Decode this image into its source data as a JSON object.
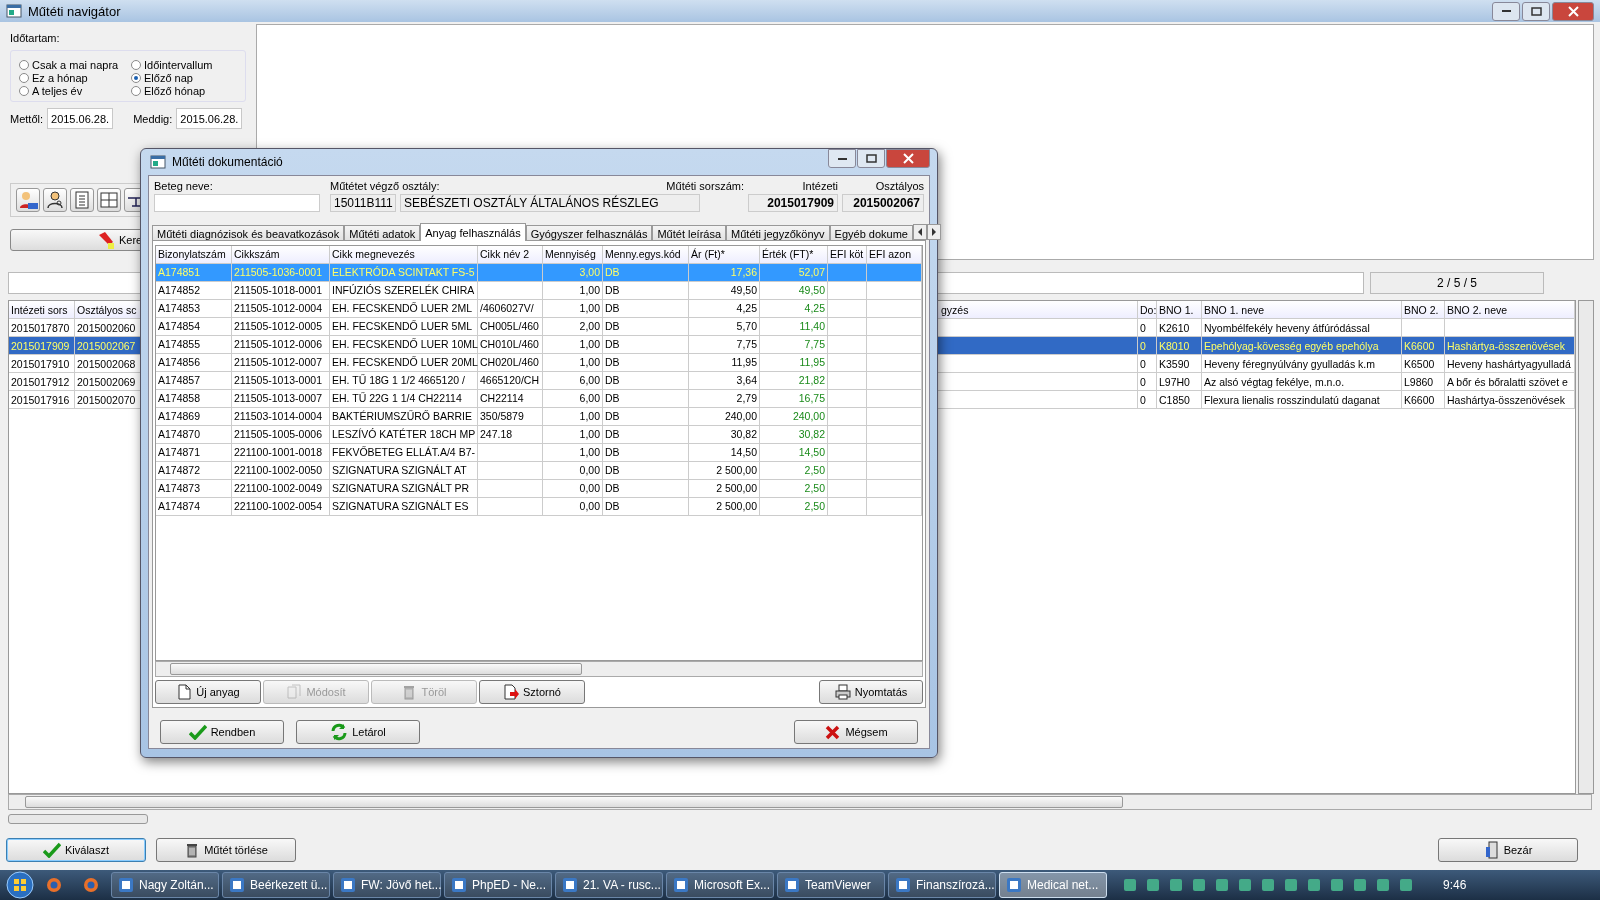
{
  "main_window": {
    "title": "Műtéti navigátor"
  },
  "period": {
    "label": "Időtartam:",
    "options": [
      {
        "label": "Csak a mai napra",
        "selected": false
      },
      {
        "label": "Időintervallum",
        "selected": false
      },
      {
        "label": "Ez a hónap",
        "selected": false
      },
      {
        "label": "Előző nap",
        "selected": true
      },
      {
        "label": "A teljes év",
        "selected": false
      },
      {
        "label": "Előző hónap",
        "selected": false
      }
    ],
    "from_label": "Mettől:",
    "from": "2015.06.28.",
    "to_label": "Meddig:",
    "to": "2015.06.28."
  },
  "search_button": "Kere",
  "record_counter": "2 / 5 / 5",
  "operations_table": {
    "columns": [
      "Intézeti sors",
      "Osztályos sc",
      "gyzés",
      "Do:",
      "BNO 1.",
      "BNO 1. neve",
      "BNO 2.",
      "BNO 2. neve"
    ],
    "rows": [
      {
        "cells": [
          "2015017870",
          "2015002060",
          null,
          "0",
          "K2610",
          "Nyombélfekély heveny átfúródással",
          null,
          null
        ],
        "selected": false
      },
      {
        "cells": [
          "2015017909",
          "2015002067",
          null,
          "0",
          "K8010",
          "Epehólyag-kövesség egyéb epehólya",
          "K6600",
          "Hashártya-összenövések"
        ],
        "selected": true
      },
      {
        "cells": [
          "2015017910",
          "2015002068",
          null,
          "0",
          "K3590",
          "Heveny féregnyúlvány gyulladás k.m",
          "K6500",
          "Heveny hashártyagyulladá"
        ],
        "selected": false
      },
      {
        "cells": [
          "2015017912",
          "2015002069",
          null,
          "0",
          "L97H0",
          "Az alsó végtag fekélye, m.n.o.",
          "L9860",
          "A bőr és bőralatti szövet e"
        ],
        "selected": false
      },
      {
        "cells": [
          "2015017916",
          "2015002070",
          null,
          "0",
          "C1850",
          "Flexura lienalis rosszindulatú daganat",
          "K6600",
          "Hashártya-összenövések"
        ],
        "selected": false
      }
    ]
  },
  "bottom_buttons": [
    {
      "label": "Kiválaszt",
      "kind": "select"
    },
    {
      "label": "Műtét törlése",
      "kind": "delete"
    },
    {
      "label": "Bezár",
      "kind": "close"
    }
  ],
  "dialog": {
    "title": "Műtéti dokumentáció",
    "patient_label": "Beteg neve:",
    "department_label": "Műtétet végző osztály:",
    "department_code": "15011B111",
    "department_name": "SEBÉSZETI OSZTÁLY ÁLTALÁNOS RÉSZLEG",
    "serial_label": "Műtéti sorszám:",
    "institution_label": "Intézeti",
    "institution_serial": "2015017909",
    "department_serial_label": "Osztályos",
    "department_serial": "2015002067",
    "tabs": [
      {
        "label": "Műtéti diagnózisok és beavatkozások",
        "selected": false
      },
      {
        "label": "Műtéti adatok",
        "selected": false
      },
      {
        "label": "Anyag felhasználás",
        "selected": true
      },
      {
        "label": "Gyógyszer felhasználás",
        "selected": false
      },
      {
        "label": "Műtét leírása",
        "selected": false
      },
      {
        "label": "Műtéti jegyzőkönyv",
        "selected": false
      },
      {
        "label": "Egyéb dokume",
        "selected": false
      }
    ],
    "table": {
      "columns": [
        "Bizonylatszám",
        "Cikkszám",
        "Cikk megnevezés",
        "Cikk név 2",
        "Mennyiség",
        "Menny.egys.kód",
        "Ár (Ft)*",
        "Érték (FT)*",
        "EFI köt",
        "EFI azon"
      ],
      "rows": [
        {
          "cells": [
            "A174851",
            "211505-1036-0001",
            "ELEKTRÓDA SCINTAKT FS-5",
            null,
            "3,00",
            "DB",
            "17,36",
            "52,07",
            null,
            null
          ],
          "selected": true
        },
        {
          "cells": [
            "A174852",
            "211505-1018-0001",
            "INFÚZIÓS SZERELÉK CHIRA",
            null,
            "1,00",
            "DB",
            "49,50",
            "49,50",
            null,
            null
          ],
          "selected": false
        },
        {
          "cells": [
            "A174853",
            "211505-1012-0004",
            "EH. FECSKENDŐ LUER 2ML",
            "/4606027V/",
            "1,00",
            "DB",
            "4,25",
            "4,25",
            null,
            null
          ],
          "selected": false
        },
        {
          "cells": [
            "A174854",
            "211505-1012-0005",
            "EH. FECSKENDŐ LUER 5ML",
            "CH005L/460",
            "2,00",
            "DB",
            "5,70",
            "11,40",
            null,
            null
          ],
          "selected": false
        },
        {
          "cells": [
            "A174855",
            "211505-1012-0006",
            "EH. FECSKENDŐ LUER 10ML",
            "CH010L/460",
            "1,00",
            "DB",
            "7,75",
            "7,75",
            null,
            null
          ],
          "selected": false
        },
        {
          "cells": [
            "A174856",
            "211505-1012-0007",
            "EH. FECSKENDŐ LUER 20ML",
            "CH020L/460",
            "1,00",
            "DB",
            "11,95",
            "11,95",
            null,
            null
          ],
          "selected": false
        },
        {
          "cells": [
            "A174857",
            "211505-1013-0001",
            "EH. TŰ 18G 1 1/2  4665120 /",
            "4665120/CH",
            "6,00",
            "DB",
            "3,64",
            "21,82",
            null,
            null
          ],
          "selected": false
        },
        {
          "cells": [
            "A174858",
            "211505-1013-0007",
            "EH. TŰ 22G 1 1/4 CH22114",
            "CH22114",
            "6,00",
            "DB",
            "2,79",
            "16,75",
            null,
            null
          ],
          "selected": false
        },
        {
          "cells": [
            "A174869",
            "211503-1014-0004",
            "BAKTÉRIUMSZŰRŐ BARRIE",
            "350/5879",
            "1,00",
            "DB",
            "240,00",
            "240,00",
            null,
            null
          ],
          "selected": false
        },
        {
          "cells": [
            "A174870",
            "211505-1005-0006",
            "LESZÍVÓ KATÉTER 18CH MP",
            "247.18",
            "1,00",
            "DB",
            "30,82",
            "30,82",
            null,
            null
          ],
          "selected": false
        },
        {
          "cells": [
            "A174871",
            "221100-1001-0018",
            "FEKVŐBETEG ELLÁT.A/4 B7-",
            null,
            "1,00",
            "DB",
            "14,50",
            "14,50",
            null,
            null
          ],
          "selected": false
        },
        {
          "cells": [
            "A174872",
            "221100-1002-0050",
            "SZIGNATURA SZIGNÁLT AT",
            null,
            "0,00",
            "DB",
            "2 500,00",
            "2,50",
            null,
            null
          ],
          "selected": false
        },
        {
          "cells": [
            "A174873",
            "221100-1002-0049",
            "SZIGNATURA SZIGNÁLT PR",
            null,
            "0,00",
            "DB",
            "2 500,00",
            "2,50",
            null,
            null
          ],
          "selected": false
        },
        {
          "cells": [
            "A174874",
            "221100-1002-0054",
            "SZIGNATURA SZIGNÁLT ES",
            null,
            "0,00",
            "DB",
            "2 500,00",
            "2,50",
            null,
            null
          ],
          "selected": false
        }
      ]
    },
    "actions": [
      {
        "label": "Új anyag",
        "kind": "new",
        "disabled": false
      },
      {
        "label": "Módosít",
        "kind": "edit",
        "disabled": true
      },
      {
        "label": "Töröl",
        "kind": "delete",
        "disabled": true
      },
      {
        "label": "Sztornó",
        "kind": "cancel",
        "disabled": false
      },
      {
        "label": "Nyomtatás",
        "kind": "print",
        "disabled": false
      }
    ],
    "footer_buttons": [
      {
        "label": "Rendben",
        "kind": "ok"
      },
      {
        "label": "Letárol",
        "kind": "save"
      },
      {
        "label": "Mégsem",
        "kind": "cancel"
      }
    ]
  },
  "taskbar": {
    "tasks": [
      {
        "label": "Nagy Zoltán...",
        "selected": false
      },
      {
        "label": "Beérkezett ü...",
        "selected": false
      },
      {
        "label": "FW: Jövő het...",
        "selected": false
      },
      {
        "label": "PhpED - Ne...",
        "selected": false
      },
      {
        "label": "21. VA - rusc...",
        "selected": false
      },
      {
        "label": "Microsoft Ex...",
        "selected": false
      },
      {
        "label": "TeamViewer",
        "selected": false
      },
      {
        "label": "Finanszírozá...",
        "selected": false
      },
      {
        "label": "Medical net...",
        "selected": true
      }
    ],
    "clock": "9:46"
  }
}
